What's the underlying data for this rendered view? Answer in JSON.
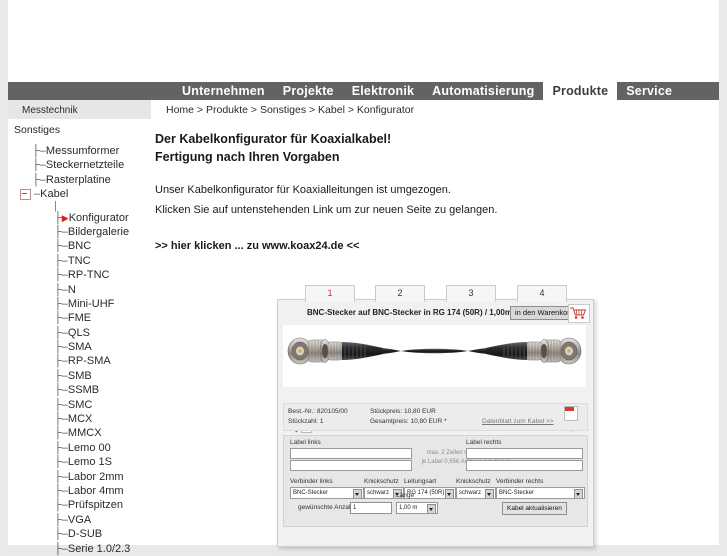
{
  "nav": {
    "items": [
      {
        "label": "Unternehmen",
        "active": false
      },
      {
        "label": "Projekte",
        "active": false
      },
      {
        "label": "Elektronik",
        "active": false
      },
      {
        "label": "Automatisierung",
        "active": false
      },
      {
        "label": "Produkte",
        "active": true
      },
      {
        "label": "Service",
        "active": false
      }
    ]
  },
  "breadcrumb": {
    "text": "Home > Produkte > Sonstiges > Kabel > Konfigurator",
    "sidebar_header": "Messtechnik"
  },
  "sidebar": {
    "section": "Sonstiges",
    "items": [
      {
        "label": "Messumformer",
        "level": 1,
        "type": "branch"
      },
      {
        "label": "Steckernetzteile",
        "level": 1,
        "type": "branch"
      },
      {
        "label": "Rasterplatine",
        "level": 1,
        "type": "branch"
      },
      {
        "label": "Kabel",
        "level": 1,
        "type": "expanded"
      },
      {
        "label": "Konfigurator",
        "level": 2,
        "type": "current"
      },
      {
        "label": "Bildergalerie",
        "level": 2,
        "type": "branch"
      },
      {
        "label": "BNC",
        "level": 2,
        "type": "branch"
      },
      {
        "label": "TNC",
        "level": 2,
        "type": "branch"
      },
      {
        "label": "RP-TNC",
        "level": 2,
        "type": "branch"
      },
      {
        "label": "N",
        "level": 2,
        "type": "branch"
      },
      {
        "label": "Mini-UHF",
        "level": 2,
        "type": "branch"
      },
      {
        "label": "FME",
        "level": 2,
        "type": "branch"
      },
      {
        "label": "QLS",
        "level": 2,
        "type": "branch"
      },
      {
        "label": "SMA",
        "level": 2,
        "type": "branch"
      },
      {
        "label": "RP-SMA",
        "level": 2,
        "type": "branch"
      },
      {
        "label": "SMB",
        "level": 2,
        "type": "branch"
      },
      {
        "label": "SSMB",
        "level": 2,
        "type": "branch"
      },
      {
        "label": "SMC",
        "level": 2,
        "type": "branch"
      },
      {
        "label": "MCX",
        "level": 2,
        "type": "branch"
      },
      {
        "label": "MMCX",
        "level": 2,
        "type": "branch"
      },
      {
        "label": "Lemo 00",
        "level": 2,
        "type": "branch"
      },
      {
        "label": "Lemo 1S",
        "level": 2,
        "type": "branch"
      },
      {
        "label": "Labor 2mm",
        "level": 2,
        "type": "branch"
      },
      {
        "label": "Labor 4mm",
        "level": 2,
        "type": "branch"
      },
      {
        "label": "Prüfspitzen",
        "level": 2,
        "type": "branch"
      },
      {
        "label": "VGA",
        "level": 2,
        "type": "branch"
      },
      {
        "label": "D-SUB",
        "level": 2,
        "type": "branch"
      },
      {
        "label": "Serie 1.0/2.3",
        "level": 2,
        "type": "branch"
      }
    ]
  },
  "main": {
    "heading_line1": "Der Kabelkonfigurator für Koaxialkabel!",
    "heading_line2": "Fertigung nach Ihren Vorgaben",
    "para1": "Unser Kabelkonfigurator für Koaxialleitungen ist umgezogen.",
    "para2": "Klicken Sie auf untenstehenden Link um zur neuen Seite zu gelangen.",
    "link": ">> hier klicken ... zu www.koax24.de <<"
  },
  "configurator": {
    "tabs": [
      {
        "label": "1",
        "active": true
      },
      {
        "label": "2",
        "active": false
      },
      {
        "label": "3",
        "active": false
      },
      {
        "label": "4",
        "active": false
      }
    ],
    "product_title": "BNC-Stecker auf BNC-Stecker in RG 174 (50R) / 1,00m",
    "cart_button": "in den Warenkorb",
    "info": {
      "bestnr_label": "Best.-Nr.:",
      "bestnr_value": "820105/00",
      "stueckzahl_label": "Stückzahl:",
      "stueckzahl_value": "1",
      "stueckpreis_label": "Stückpreis:",
      "stueckpreis_value": "10,80 EUR",
      "gesamtpreis_label": "Gesamtpreis:",
      "gesamtpreis_value": "10,80 EUR *",
      "datasheet_link": "Datenblatt zum Kabel >>"
    },
    "form": {
      "label_links": "Label links",
      "label_rechts": "Label rechts",
      "label_links_value": "",
      "label_links_value2": "",
      "label_rechts_value": "",
      "label_rechts_value2": "",
      "hint_line1": "max. 2 Zeilen mit je 15 Zeichen",
      "hint_line2": "je Label 0,95€ Aufpreis pro Kabel",
      "verbinder_links_label": "Verbinder links",
      "verbinder_links_value": "BNC-Stecker",
      "knickschutz_links_label": "Knickschutz",
      "knickschutz_links_value": "schwarz",
      "leitungsart_label": "Leitungsart",
      "leitungsart_value": "RG 174 (50R)",
      "knickschutz_rechts_label": "Knickschutz",
      "knickschutz_rechts_value": "schwarz",
      "verbinder_rechts_label": "Verbinder rechts",
      "verbinder_rechts_value": "BNC-Stecker",
      "anzahl_label": "gewünschte Anzahl: x",
      "anzahl_value": "1",
      "laenge_label": "Länge",
      "laenge_value": "1,00 m",
      "update_button": "Kabel aktualisieren"
    }
  },
  "colors": {
    "nav_bg": "#636363",
    "accent_red": "#d2322d",
    "page_bg": "#e9e9e9"
  }
}
